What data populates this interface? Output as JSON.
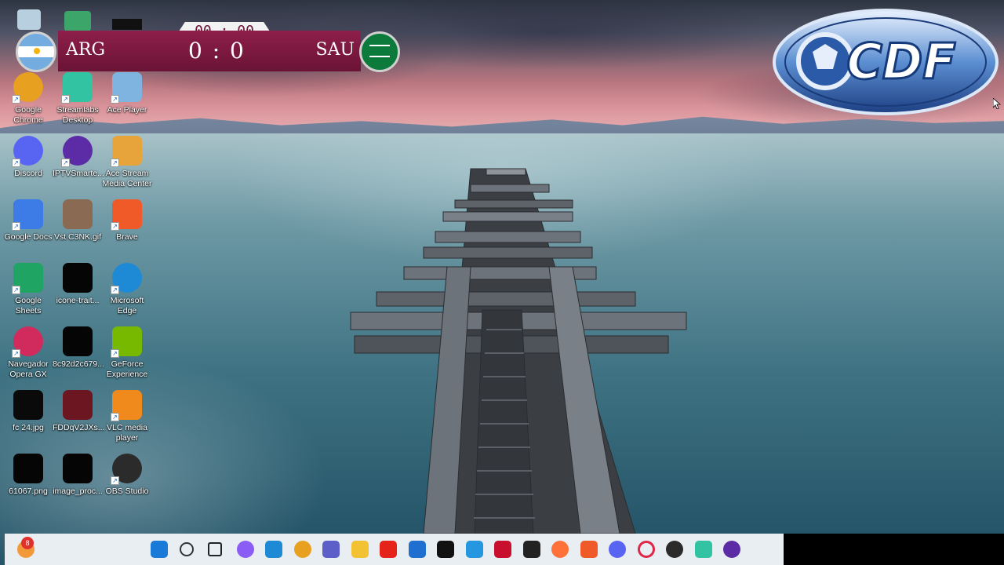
{
  "scoreboard": {
    "timer": "00 : 00",
    "home_team": "ARG",
    "away_team": "SAU",
    "score": "0 : 0",
    "bar_color": "#7d1a41"
  },
  "logo": {
    "text": "CDF"
  },
  "desktop_icons": [
    {
      "label": "Google Chrome",
      "icon": "chrome-icon"
    },
    {
      "label": "Streamlabs Desktop",
      "icon": "streamlabs-icon"
    },
    {
      "label": "Ace Player",
      "icon": "ace-player-icon"
    },
    {
      "label": "Discord",
      "icon": "discord-icon"
    },
    {
      "label": "IPTVSmarte...",
      "icon": "iptv-smarters-icon"
    },
    {
      "label": "Ace Stream Media Center",
      "icon": "ace-stream-icon"
    },
    {
      "label": "Google Docs",
      "icon": "google-docs-icon"
    },
    {
      "label": "Vst C3NK.gif",
      "icon": "gif-file-icon"
    },
    {
      "label": "Brave",
      "icon": "brave-icon"
    },
    {
      "label": "Google Sheets",
      "icon": "google-sheets-icon"
    },
    {
      "label": "icone-trait...",
      "icon": "black-file-icon"
    },
    {
      "label": "Microsoft Edge",
      "icon": "edge-icon"
    },
    {
      "label": "Navegador Opera GX",
      "icon": "opera-gx-icon"
    },
    {
      "label": "8c92d2c679...",
      "icon": "black-file-icon"
    },
    {
      "label": "GeForce Experience",
      "icon": "geforce-icon"
    },
    {
      "label": "fc 24.jpg",
      "icon": "jpg-file-icon"
    },
    {
      "label": "FDDqV2JXs...",
      "icon": "image-file-icon"
    },
    {
      "label": "VLC media player",
      "icon": "vlc-icon"
    },
    {
      "label": "61067.png",
      "icon": "black-file-icon"
    },
    {
      "label": "image_proc...",
      "icon": "black-file-icon"
    },
    {
      "label": "OBS Studio",
      "icon": "obs-icon"
    }
  ],
  "taskbar": {
    "notification_count": "8",
    "icons": [
      "start-icon",
      "search-icon",
      "task-view-icon",
      "copilot-icon",
      "edge-icon",
      "chrome-icon",
      "teams-icon",
      "file-explorer-icon",
      "diamond-app-icon",
      "store-icon",
      "pluto-tv-icon",
      "photos-icon",
      "mcafee-icon",
      "speedometer-icon",
      "firefox-icon",
      "brave-icon",
      "discord-icon",
      "opera-icon",
      "obs-icon",
      "streamlabs-icon",
      "iptv-icon"
    ]
  }
}
